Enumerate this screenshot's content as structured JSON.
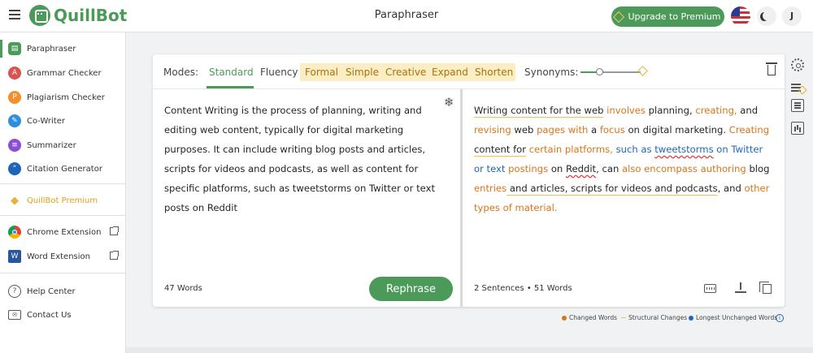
{
  "header": {
    "brand": "QuillBot",
    "title": "Paraphraser",
    "upgrade_label": "Upgrade to Premium",
    "avatar_initial": "J"
  },
  "sidebar": {
    "items": [
      {
        "label": "Paraphraser",
        "icon": "paraphraser-icon",
        "color": "#4c9a5a"
      },
      {
        "label": "Grammar Checker",
        "icon": "grammar-icon",
        "color": "#d9534f"
      },
      {
        "label": "Plagiarism Checker",
        "icon": "plagiarism-icon",
        "color": "#f0912d"
      },
      {
        "label": "Co-Writer",
        "icon": "co-writer-icon",
        "color": "#2f8ee0"
      },
      {
        "label": "Summarizer",
        "icon": "summarizer-icon",
        "color": "#8a4fd4"
      },
      {
        "label": "Citation Generator",
        "icon": "citation-icon",
        "color": "#1f66b8"
      },
      {
        "label": "QuillBot Premium",
        "icon": "premium-diamond-icon",
        "color": "#e6b23a"
      },
      {
        "label": "Chrome Extension",
        "icon": "chrome-icon",
        "color": "#db4437"
      },
      {
        "label": "Word Extension",
        "icon": "word-icon",
        "color": "#2b579a"
      },
      {
        "label": "Help Center",
        "icon": "help-icon",
        "color": "#555555"
      },
      {
        "label": "Contact Us",
        "icon": "mail-icon",
        "color": "#555555"
      }
    ]
  },
  "modes": {
    "label": "Modes:",
    "free": [
      "Standard",
      "Fluency"
    ],
    "premium": [
      "Formal",
      "Simple",
      "Creative",
      "Expand",
      "Shorten"
    ],
    "active": "Standard",
    "synonyms_label": "Synonyms:",
    "synonyms_level": 0.3
  },
  "input": {
    "text": "Content Writing is the process of planning, writing and editing web content, typically for digital marketing purposes. It can include writing blog posts and articles, scripts for videos and podcasts, as well as content for specific platforms, such as tweetstorms on Twitter or text posts on Reddit",
    "word_count": "47 Words",
    "rephrase_label": "Rephrase"
  },
  "output": {
    "segments": [
      {
        "t": "Writing content for the web",
        "c": "struct"
      },
      {
        "t": " ",
        "c": ""
      },
      {
        "t": "involves",
        "c": "changed"
      },
      {
        "t": " planning, ",
        "c": ""
      },
      {
        "t": "creating,",
        "c": "changed"
      },
      {
        "t": " and ",
        "c": ""
      },
      {
        "t": "revising",
        "c": "changed"
      },
      {
        "t": " web ",
        "c": ""
      },
      {
        "t": "pages with",
        "c": "changed"
      },
      {
        "t": " a ",
        "c": ""
      },
      {
        "t": "focus",
        "c": "changed"
      },
      {
        "t": " on digital marketing. ",
        "c": ""
      },
      {
        "t": "Creating",
        "c": "changed"
      },
      {
        "t": " ",
        "c": ""
      },
      {
        "t": "content for",
        "c": "struct"
      },
      {
        "t": " ",
        "c": ""
      },
      {
        "t": "certain platforms,",
        "c": "changed"
      },
      {
        "t": " ",
        "c": ""
      },
      {
        "t": "such as ",
        "c": "long"
      },
      {
        "t": "tweetstorms",
        "c": "long-spell"
      },
      {
        "t": " on Twitter or text",
        "c": "long"
      },
      {
        "t": " ",
        "c": ""
      },
      {
        "t": "postings",
        "c": "changed"
      },
      {
        "t": " on ",
        "c": ""
      },
      {
        "t": "Reddit",
        "c": "spell"
      },
      {
        "t": ", can ",
        "c": ""
      },
      {
        "t": "also encompass authoring",
        "c": "changed"
      },
      {
        "t": " blog ",
        "c": ""
      },
      {
        "t": "entries",
        "c": "changed"
      },
      {
        "t": " and articles, scripts for videos and podcasts",
        "c": "struct"
      },
      {
        "t": ", and ",
        "c": ""
      },
      {
        "t": "other types of material.",
        "c": "changed"
      }
    ],
    "stats": "2 Sentences • 51 Words"
  },
  "legend": {
    "changed": "Changed Words",
    "structural": "Structural Changes",
    "longest": "Longest Unchanged Words"
  },
  "colors": {
    "accent": "#4c9a5a",
    "changed": "#d7751a",
    "structural": "#e9c64a",
    "longest": "#1f66b8"
  }
}
